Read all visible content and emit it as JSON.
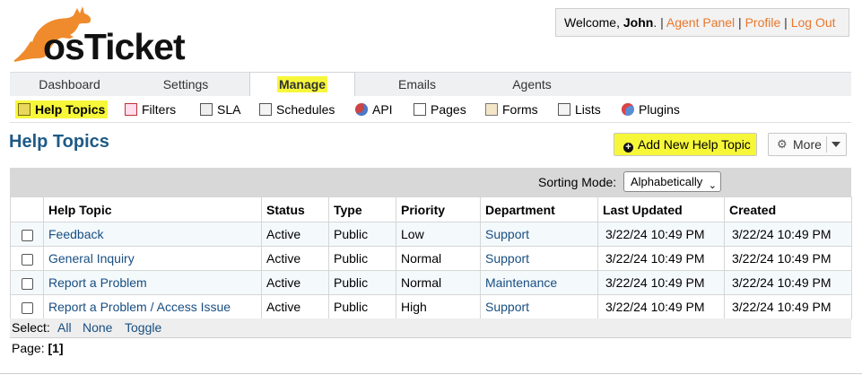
{
  "logo": {
    "text": "osTicket"
  },
  "user_bar": {
    "welcome_prefix": "Welcome, ",
    "user_name": "John",
    "links": [
      "Agent Panel",
      "Profile",
      "Log Out"
    ]
  },
  "nav_tabs": [
    "Dashboard",
    "Settings",
    "Manage",
    "Emails",
    "Agents"
  ],
  "active_tab": "Manage",
  "sub_nav": [
    "Help Topics",
    "Filters",
    "SLA",
    "Schedules",
    "API",
    "Pages",
    "Forms",
    "Lists",
    "Plugins"
  ],
  "active_sub": "Help Topics",
  "page_title": "Help Topics",
  "actions": {
    "add_label": "Add New Help Topic",
    "more_label": "More"
  },
  "sorting": {
    "label": "Sorting Mode:",
    "value": "Alphabetically"
  },
  "table": {
    "headers": [
      "Help Topic",
      "Status",
      "Type",
      "Priority",
      "Department",
      "Last Updated",
      "Created"
    ],
    "rows": [
      [
        "Feedback",
        "Active",
        "Public",
        "Low",
        "Support",
        "3/22/24 10:49 PM",
        "3/22/24 10:49 PM"
      ],
      [
        "General Inquiry",
        "Active",
        "Public",
        "Normal",
        "Support",
        "3/22/24 10:49 PM",
        "3/22/24 10:49 PM"
      ],
      [
        "Report a Problem",
        "Active",
        "Public",
        "Normal",
        "Maintenance",
        "3/22/24 10:49 PM",
        "3/22/24 10:49 PM"
      ],
      [
        "Report a Problem / Access Issue",
        "Active",
        "Public",
        "High",
        "Support",
        "3/22/24 10:49 PM",
        "3/22/24 10:49 PM"
      ]
    ]
  },
  "select_bar": {
    "label": "Select:",
    "all": "All",
    "none": "None",
    "toggle": "Toggle"
  },
  "pagination": {
    "label": "Page:",
    "current": "[1]"
  },
  "highlight_color": "#f7f73a",
  "accent_color": "#1f5a86",
  "link_orange": "#e8782d"
}
